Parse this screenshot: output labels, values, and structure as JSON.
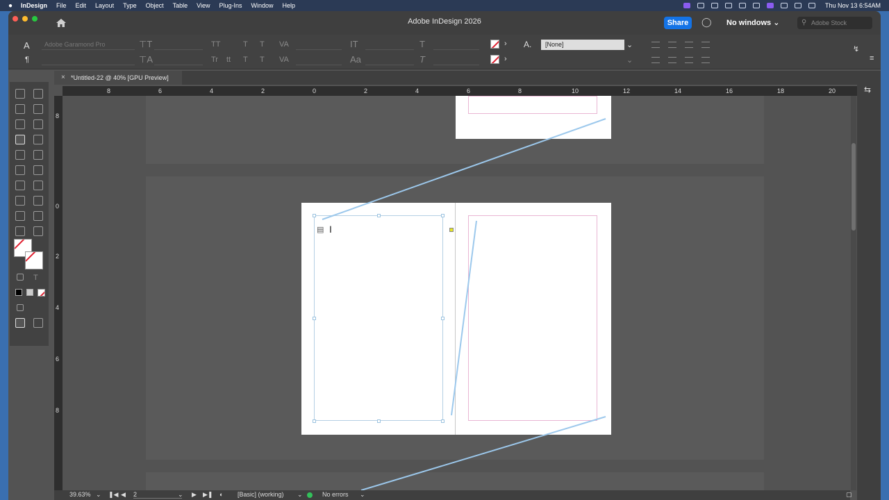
{
  "menubar": {
    "app_name": "InDesign",
    "menus": [
      "File",
      "Edit",
      "Layout",
      "Type",
      "Object",
      "Table",
      "View",
      "Plug-Ins",
      "Window",
      "Help"
    ],
    "clock": "Thu Nov 13  6:54AM"
  },
  "window": {
    "title": "Adobe InDesign 2026",
    "share_label": "Share",
    "workspace_label": "No windows",
    "stock_placeholder": "Adobe Stock"
  },
  "control": {
    "font_family": "Adobe Garamond Pro",
    "char_style": "[None]"
  },
  "document": {
    "tab_title": "*Untitled-22 @ 40% [GPU Preview]"
  },
  "ruler": {
    "h_labels": [
      "8",
      "6",
      "4",
      "2",
      "0",
      "2",
      "4",
      "6",
      "8",
      "10",
      "12",
      "14",
      "16",
      "18",
      "20"
    ],
    "v_labels": [
      "8",
      "0",
      "2",
      "4",
      "6",
      "8"
    ]
  },
  "status": {
    "zoom": "39.63%",
    "page": "2",
    "style": "[Basic] (working)",
    "preflight": "No errors"
  },
  "colors": {
    "accent": "#1473e6",
    "thread": "#9cc8ec",
    "margin": "#e9b5d3",
    "ok": "#33c05a"
  }
}
